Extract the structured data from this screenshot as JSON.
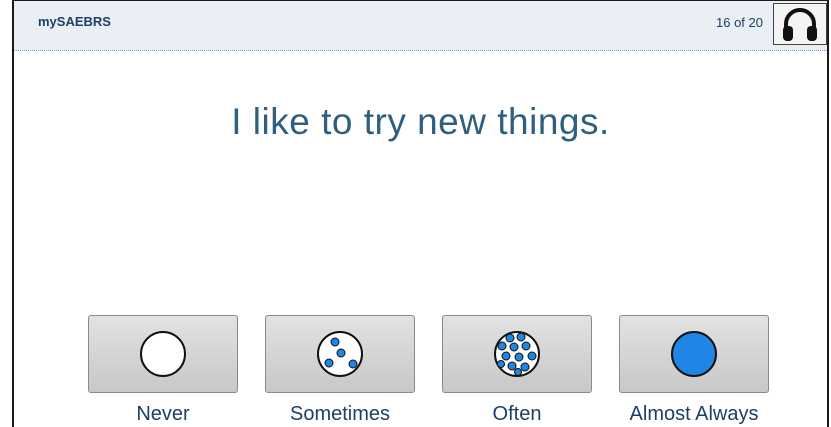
{
  "header": {
    "app_title": "mySAEBRS",
    "progress": "16 of 20",
    "audio_icon": "headphones-icon"
  },
  "question": {
    "text": "I like to try new things."
  },
  "options": [
    {
      "label": "Never",
      "icon": "empty-circle-icon"
    },
    {
      "label": "Sometimes",
      "icon": "few-dots-circle-icon"
    },
    {
      "label": "Often",
      "icon": "many-dots-circle-icon"
    },
    {
      "label": "Almost Always",
      "icon": "filled-circle-icon"
    }
  ],
  "colors": {
    "accent_blue": "#1f86e5",
    "text_blue": "#2f5f7f",
    "header_bg": "#e9eff4"
  }
}
